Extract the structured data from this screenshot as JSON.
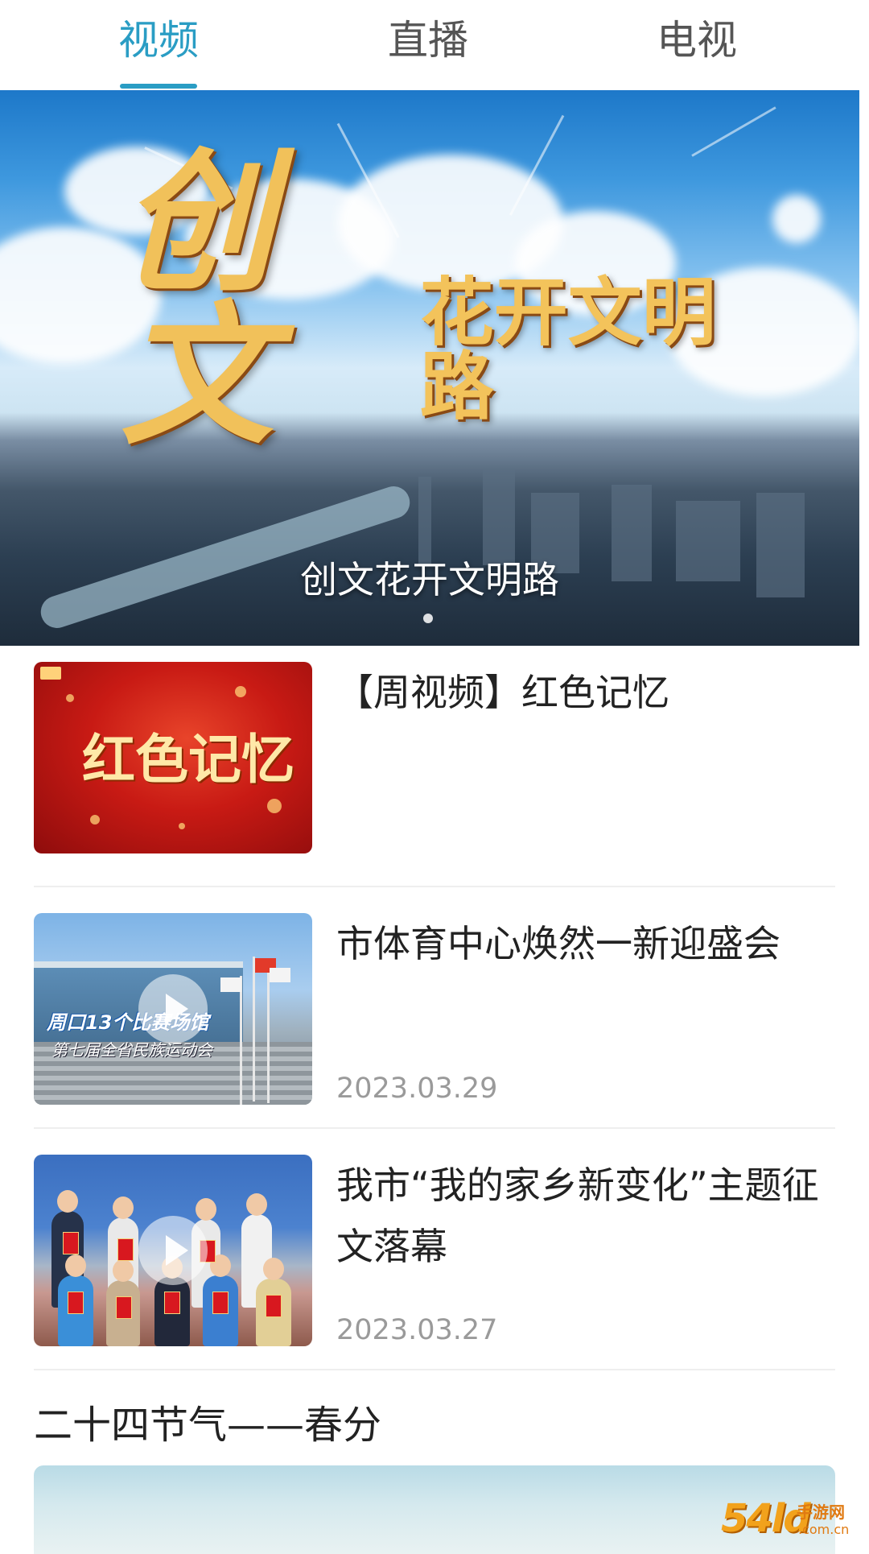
{
  "tabs": [
    {
      "label": "视频",
      "active": true
    },
    {
      "label": "直播",
      "active": false
    },
    {
      "label": "电视",
      "active": false
    }
  ],
  "accent_color": "#2a9dc4",
  "hero": {
    "art_big": "创文",
    "art_small": "花开文明路",
    "caption": "创文花开文明路",
    "slide_count": 1,
    "current_slide": 1
  },
  "news": [
    {
      "title": "【周视频】红色记忆",
      "date": "",
      "thumb_text": "红色记忆",
      "has_play_icon": false
    },
    {
      "title": "市体育中心焕然一新迎盛会",
      "date": "2023.03.29",
      "thumb_text_1": "周口13个比赛场馆",
      "thumb_text_2": "第七届全省民族运动会",
      "has_play_icon": true
    },
    {
      "title": "我市“我的家乡新变化”主题征文落幕",
      "date": "2023.03.27",
      "has_play_icon": true
    }
  ],
  "section": {
    "title": "二十四节气——春分"
  },
  "watermark": {
    "logo": "54ld",
    "site": "手游网",
    "domain": ".com.cn"
  }
}
